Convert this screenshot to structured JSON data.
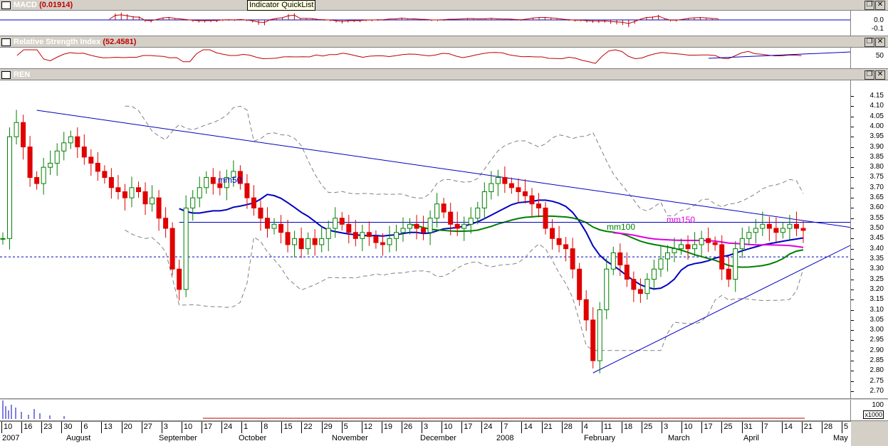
{
  "macd": {
    "title": "MACD",
    "value": "(0.01914)",
    "ticks": [
      "0.0",
      "-0.1"
    ]
  },
  "tooltip": "Indicator QuickList",
  "rsi": {
    "title": "Relative Strength Index",
    "value": "(52.4581)",
    "ticks": [
      "50"
    ]
  },
  "main": {
    "title": "REN",
    "ma_labels": [
      "mm50",
      "mm100",
      "mm150"
    ]
  },
  "volume": {
    "unit_label": "x1000",
    "tick_label": "100"
  },
  "colors": {
    "up": "#008000",
    "down": "#e00000",
    "trend": "#0000c0",
    "mm50": "#0000c0",
    "mm100": "#008000",
    "mm150": "#e000e0",
    "bands": "#808080"
  },
  "chart_data": {
    "type": "candlestick",
    "title": "REN",
    "ylim": [
      2.7,
      4.15
    ],
    "y_ticks": [
      "4.15",
      "4.10",
      "4.05",
      "4.00",
      "3.95",
      "3.90",
      "3.85",
      "3.80",
      "3.75",
      "3.70",
      "3.65",
      "3.60",
      "3.55",
      "3.50",
      "3.45",
      "3.40",
      "3.35",
      "3.30",
      "3.25",
      "3.20",
      "3.15",
      "3.10",
      "3.05",
      "3.00",
      "2.95",
      "2.90",
      "2.85",
      "2.80",
      "2.75",
      "2.70"
    ],
    "x_day_labels": [
      "10",
      "16",
      "23",
      "30",
      "6",
      "13",
      "20",
      "27",
      "3",
      "10",
      "17",
      "24",
      "1",
      "8",
      "15",
      "22",
      "29",
      "5",
      "12",
      "19",
      "26",
      "3",
      "10",
      "17",
      "24",
      "7",
      "14",
      "21",
      "28",
      "4",
      "11",
      "18",
      "25",
      "3",
      "10",
      "17",
      "25",
      "31",
      "7",
      "14",
      "21",
      "28",
      "5"
    ],
    "x_month_labels": [
      "2007",
      "August",
      "September",
      "October",
      "November",
      "December",
      "2008",
      "February",
      "March",
      "April",
      "May"
    ],
    "close_series": [
      3.45,
      3.95,
      4.02,
      3.9,
      3.75,
      3.72,
      3.8,
      3.82,
      3.88,
      3.92,
      3.95,
      3.9,
      3.85,
      3.82,
      3.78,
      3.75,
      3.7,
      3.68,
      3.65,
      3.7,
      3.68,
      3.62,
      3.65,
      3.55,
      3.5,
      3.3,
      3.2,
      3.6,
      3.65,
      3.7,
      3.75,
      3.72,
      3.7,
      3.75,
      3.78,
      3.72,
      3.65,
      3.6,
      3.55,
      3.5,
      3.52,
      3.48,
      3.42,
      3.45,
      3.4,
      3.45,
      3.42,
      3.45,
      3.5,
      3.55,
      3.52,
      3.48,
      3.45,
      3.48,
      3.46,
      3.43,
      3.42,
      3.45,
      3.48,
      3.5,
      3.52,
      3.5,
      3.48,
      3.55,
      3.62,
      3.58,
      3.52,
      3.5,
      3.52,
      3.55,
      3.6,
      3.68,
      3.72,
      3.75,
      3.72,
      3.7,
      3.68,
      3.66,
      3.62,
      3.6,
      3.5,
      3.45,
      3.42,
      3.4,
      3.3,
      3.15,
      3.05,
      2.85,
      3.1,
      3.3,
      3.38,
      3.32,
      3.25,
      3.2,
      3.18,
      3.25,
      3.3,
      3.35,
      3.38,
      3.4,
      3.42,
      3.4,
      3.42,
      3.45,
      3.43,
      3.42,
      3.3,
      3.25,
      3.4,
      3.45,
      3.48,
      3.5,
      3.52,
      3.5,
      3.48,
      3.5,
      3.52,
      3.5,
      3.49
    ],
    "trendlines": [
      {
        "from": {
          "i": 5,
          "y": 4.08
        },
        "to": {
          "i": 126,
          "y": 3.5
        }
      },
      {
        "from": {
          "i": 87,
          "y": 2.79
        },
        "to": {
          "i": 130,
          "y": 3.5
        }
      },
      {
        "from": {
          "i": 26,
          "y": 3.53
        },
        "to": {
          "i": 126,
          "y": 3.53
        }
      }
    ],
    "horizontal_dashed": 3.36
  }
}
